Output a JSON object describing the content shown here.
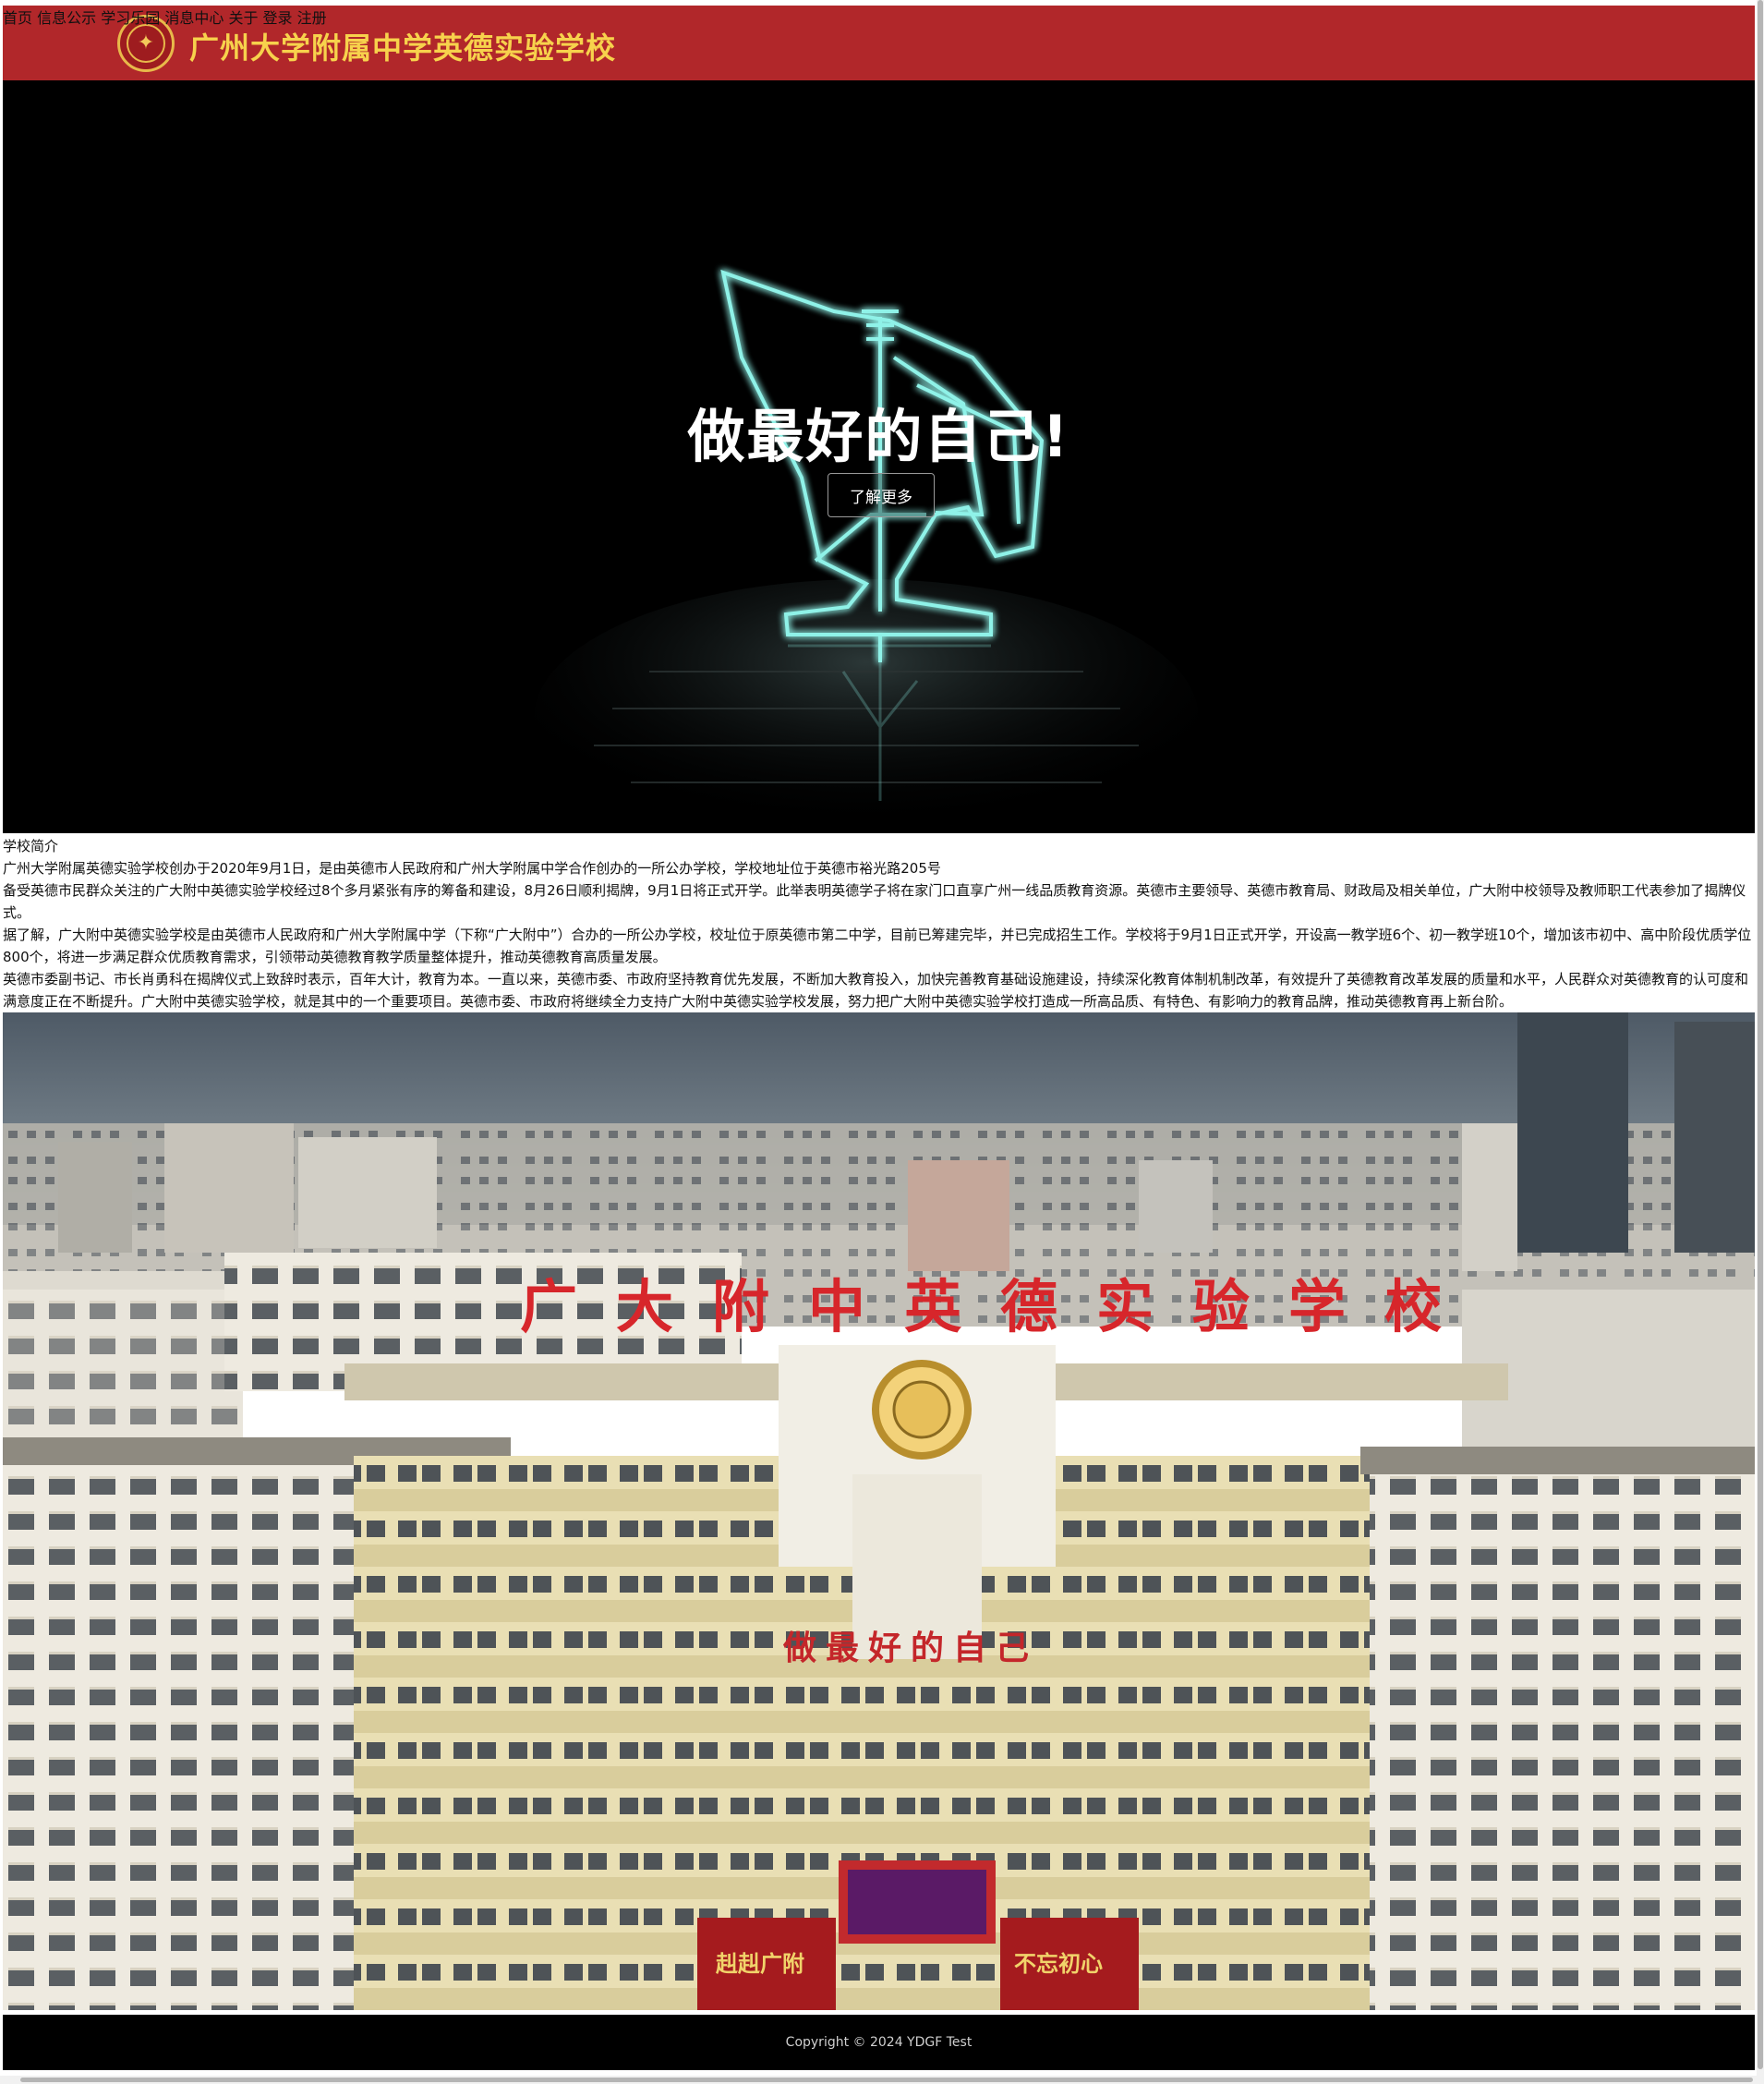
{
  "header": {
    "title": "广州大学附属中学英德实验学校",
    "logo_icon": "school-emblem-icon",
    "nav": [
      {
        "label": "首页"
      },
      {
        "label": "信息公示"
      },
      {
        "label": "学习乐园"
      },
      {
        "label": "消息中心"
      },
      {
        "label": "关于"
      },
      {
        "label": "登录"
      },
      {
        "label": "注册"
      }
    ]
  },
  "hero": {
    "headline": "做最好的自己!",
    "button_label": "了解更多"
  },
  "intro": {
    "heading": "学校简介",
    "paragraphs": [
      "广州大学附属英德实验学校创办于2020年9月1日，是由英德市人民政府和广州大学附属中学合作创办的一所公办学校，学校地址位于英德市裕光路205号",
      "备受英德市民群众关注的广大附中英德实验学校经过8个多月紧张有序的筹备和建设，8月26日顺利揭牌，9月1日将正式开学。此举表明英德学子将在家门口直享广州一线品质教育资源。英德市主要领导、英德市教育局、财政局及相关单位，广大附中校领导及教师职工代表参加了揭牌仪式。",
      "据了解，广大附中英德实验学校是由英德市人民政府和广州大学附属中学（下称“广大附中”）合办的一所公办学校，校址位于原英德市第二中学，目前已筹建完毕，并已完成招生工作。学校将于9月1日正式开学，开设高一教学班6个、初一教学班10个，增加该市初中、高中阶段优质学位800个，将进一步满足群众优质教育需求，引领带动英德教育教学质量整体提升，推动英德教育高质量发展。",
      "英德市委副书记、市长肖勇科在揭牌仪式上致辞时表示，百年大计，教育为本。一直以来，英德市委、市政府坚持教育优先发展，不断加大教育投入，加快完善教育基础设施建设，持续深化教育体制机制改革，有效提升了英德教育改革发展的质量和水平，人民群众对英德教育的认可度和满意度正在不断提升。广大附中英德实验学校，就是其中的一个重要项目。英德市委、市政府将继续全力支持广大附中英德实验学校发展，努力把广大附中英德实验学校打造成一所高品质、有特色、有影响力的教育品牌，推动英德教育再上新台阶。"
    ]
  },
  "photo": {
    "sign_text": "广大附中英德实验学校",
    "motto": "做最好的自己",
    "banner_left": "赳赳广附",
    "banner_right": "不忘初心"
  },
  "footer": {
    "copyright": "Copyright © 2024 YDGF Test"
  }
}
